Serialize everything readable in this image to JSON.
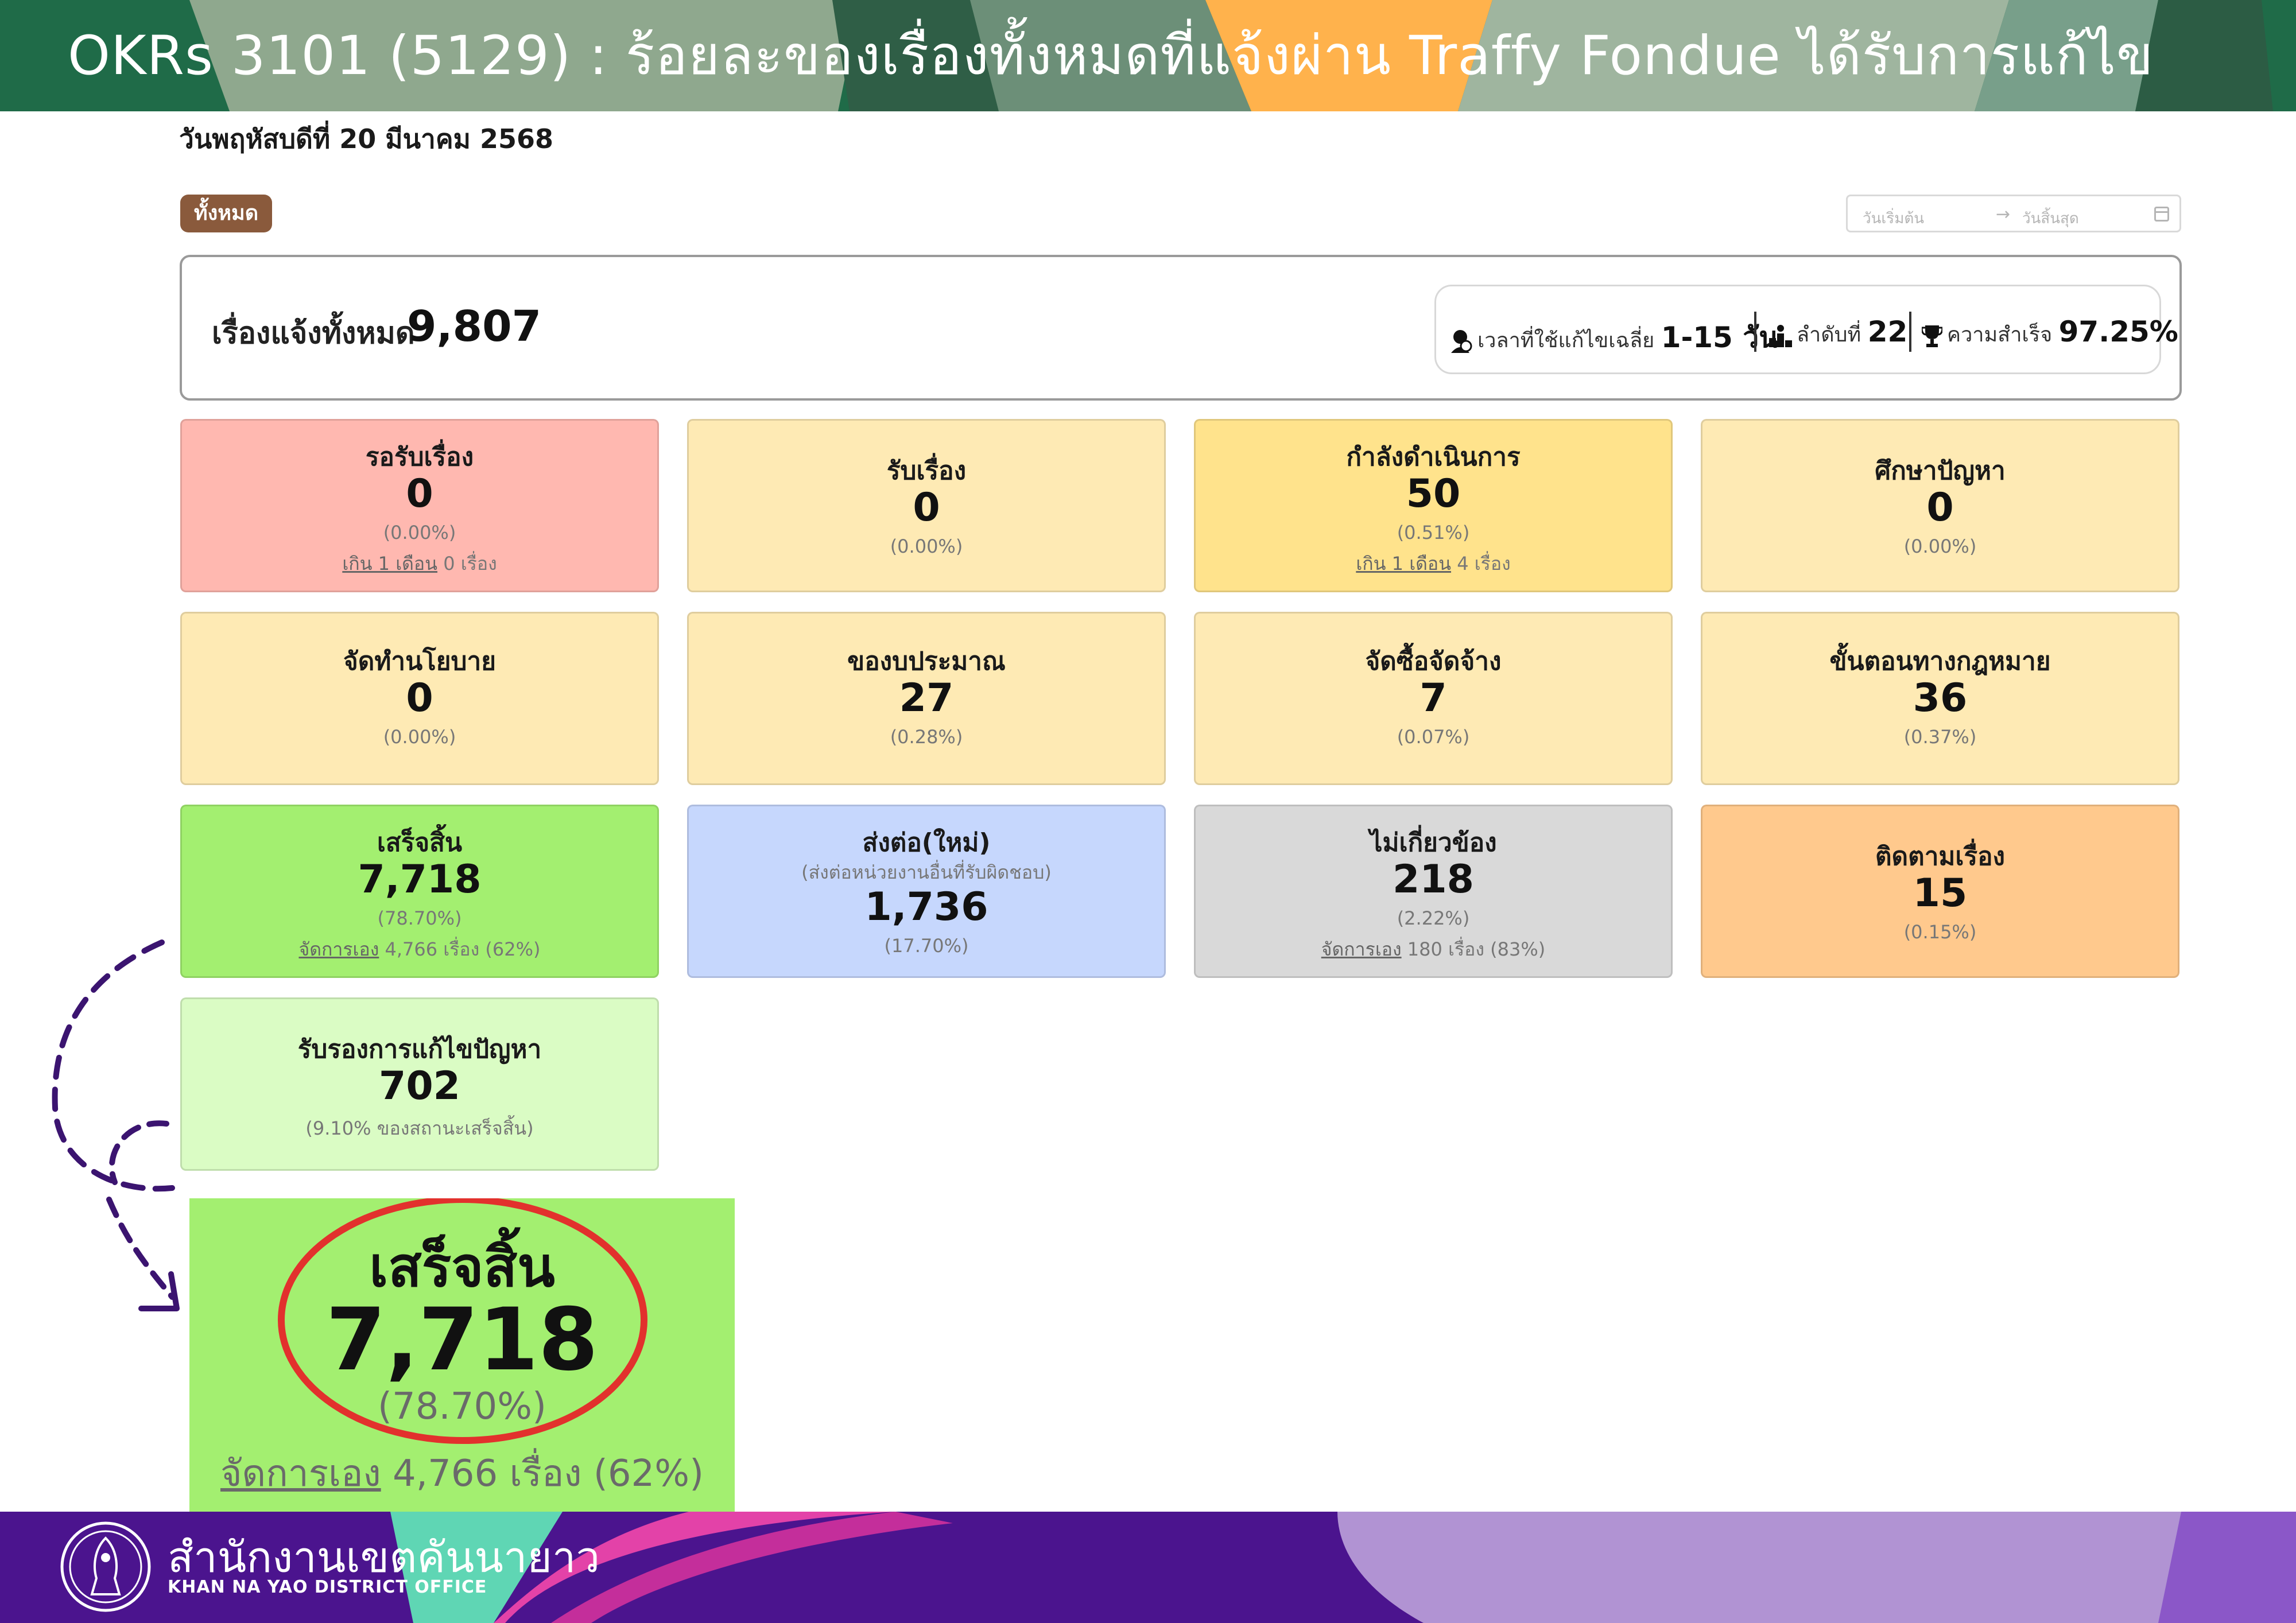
{
  "header": {
    "title": "OKRs 3101 (5129) : ร้อยละของเรื่องทั้งหมดที่แจ้งผ่าน Traffy Fondue ได้รับการแก้ไข"
  },
  "dashboard": {
    "date": "วันพฤหัสบดีที่ 20 มีนาคม 2568",
    "filter_label": "ทั้งหมด",
    "date_range": {
      "start_placeholder": "วันเริ่มต้น",
      "arrow": "→",
      "end_placeholder": "วันสิ้นสุด"
    },
    "summary": {
      "label": "เรื่องแจ้งทั้งหมด",
      "total": "9,807",
      "avg_time_label": "เวลาที่ใช้แก้ไขเฉลี่ย",
      "avg_time_value": "1-15 วัน",
      "rank_label": "ลำดับที่",
      "rank_value": "22",
      "success_label": "ความสำเร็จ",
      "success_value": "97.25%"
    },
    "cards": [
      {
        "title": "รอรับเรื่อง",
        "value": "0",
        "pct": "(0.00%)",
        "sub_link": "เกิน 1 เดือน",
        "sub_rest": " 0 เรื่อง",
        "bg": "#ffb8b0"
      },
      {
        "title": "รับเรื่อง",
        "value": "0",
        "pct": "(0.00%)",
        "bg": "#feeab4"
      },
      {
        "title": "กำลังดำเนินการ",
        "value": "50",
        "pct": "(0.51%)",
        "sub_link": "เกิน 1 เดือน",
        "sub_rest": " 4 เรื่อง",
        "bg": "#ffe38c"
      },
      {
        "title": "ศึกษาปัญหา",
        "value": "0",
        "pct": "(0.00%)",
        "bg": "#feeab4"
      },
      {
        "title": "จัดทำนโยบาย",
        "value": "0",
        "pct": "(0.00%)",
        "bg": "#feeab4"
      },
      {
        "title": "ของบประมาณ",
        "value": "27",
        "pct": "(0.28%)",
        "bg": "#feeab4"
      },
      {
        "title": "จัดซื้อจัดจ้าง",
        "value": "7",
        "pct": "(0.07%)",
        "bg": "#feeab4"
      },
      {
        "title": "ขั้นตอนทางกฎหมาย",
        "value": "36",
        "pct": "(0.37%)",
        "bg": "#feeab4"
      },
      {
        "title": "เสร็จสิ้น",
        "value": "7,718",
        "pct": "(78.70%)",
        "sub_link": "จัดการเอง",
        "sub_rest": " 4,766 เรื่อง (62%)",
        "bg": "#a3ef70"
      },
      {
        "title": "ส่งต่อ(ใหม่)",
        "subtitle": "(ส่งต่อหน่วยงานอื่นที่รับผิดชอบ)",
        "value": "1,736",
        "pct": "(17.70%)",
        "bg": "#c6d7fd"
      },
      {
        "title": "ไม่เกี่ยวข้อง",
        "value": "218",
        "pct": "(2.22%)",
        "sub_link": "จัดการเอง",
        "sub_rest": " 180 เรื่อง (83%)",
        "bg": "#d9d9d9"
      },
      {
        "title": "ติดตามเรื่อง",
        "value": "15",
        "pct": "(0.15%)",
        "bg": "#ffc98d"
      },
      {
        "title": "รับรองการแก้ไขปัญหา",
        "value": "702",
        "pct": "(9.10% ของสถานะเสร็จสิ้น)",
        "bg": "#dafcc4"
      }
    ]
  },
  "zoom": {
    "title": "เสร็จสิ้น",
    "value": "7,718",
    "pct": "(78.70%)",
    "sub_link": "จัดการเอง",
    "sub_rest": " 4,766 เรื่อง (62%)",
    "highlight_color": "#e2312d"
  },
  "footer": {
    "name_th": "สำนักงานเขตคันนายาว",
    "name_en": "KHAN NA YAO DISTRICT OFFICE"
  },
  "colors": {
    "header_green": "#1f6b48",
    "header_accent_orange": "#ffb24c",
    "footer_purple": "#4b148e",
    "footer_lilac": "#b193d3",
    "footer_pink": "#e342a8",
    "footer_mint": "#5fd6b4",
    "annotation_purple": "#3b1470"
  },
  "icons": [
    "user-clock-icon",
    "ranking-icon",
    "trophy-icon",
    "calendar-icon",
    "district-seal-icon"
  ]
}
